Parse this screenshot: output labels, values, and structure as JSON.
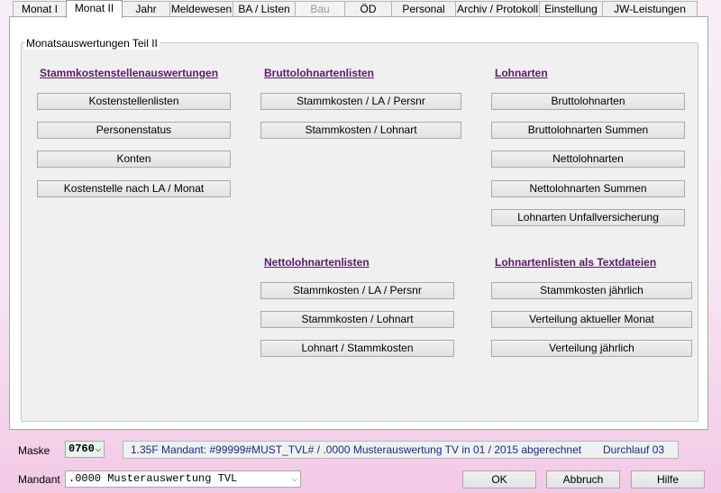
{
  "tabs": [
    {
      "label": "Monat I",
      "state": "normal"
    },
    {
      "label": "Monat II",
      "state": "active"
    },
    {
      "label": "Jahr",
      "state": "normal"
    },
    {
      "label": "Meldewesen",
      "state": "normal"
    },
    {
      "label": "BA / Listen",
      "state": "normal"
    },
    {
      "label": "Bau",
      "state": "disabled"
    },
    {
      "label": "ÖD",
      "state": "normal"
    },
    {
      "label": "Personal",
      "state": "normal"
    },
    {
      "label": "Archiv / Protokoll",
      "state": "normal"
    },
    {
      "label": "Einstellung",
      "state": "normal"
    },
    {
      "label": "JW-Leistungen",
      "state": "normal"
    }
  ],
  "group_title": "Monatsauswertungen Teil II",
  "sections": {
    "stammkosten": {
      "heading": "Stammkostenstellenauswertungen",
      "buttons": [
        "Kostenstellenlisten",
        "Personenstatus",
        "Konten",
        "Kostenstelle nach LA / Monat"
      ]
    },
    "brutto": {
      "heading": "Bruttolohnartenlisten",
      "buttons": [
        "Stammkosten / LA / Persnr",
        "Stammkosten / Lohnart"
      ]
    },
    "lohnarten": {
      "heading": "Lohnarten",
      "buttons": [
        "Bruttolohnarten",
        "Bruttolohnarten Summen",
        "Nettolohnarten",
        "Nettolohnarten Summen",
        "Lohnarten Unfallversicherung"
      ]
    },
    "netto": {
      "heading": "Nettolohnartenlisten",
      "buttons": [
        "Stammkosten / LA / Persnr",
        "Stammkosten / Lohnart",
        "Lohnart / Stammkosten"
      ]
    },
    "textdateien": {
      "heading": "Lohnartenlisten als Textdateien",
      "buttons": [
        "Stammkosten jährlich",
        "Verteilung aktueller Monat",
        "Verteilung jährlich"
      ]
    }
  },
  "footer": {
    "maske_label": "Maske",
    "maske_value": "0760",
    "status_text": "1.35F Mandant: #99999#MUST_TVL# / .0000 Musterauswertung TV in 01 / 2015 abgerechnet",
    "status_run": "Durchlauf 03",
    "mandant_label": "Mandant",
    "mandant_value": ".0000 Musterauswertung TVL",
    "ok_label": "OK",
    "abbruch_label": "Abbruch",
    "hilfe_label": "Hilfe"
  },
  "colors": {
    "heading": "#5a1a66",
    "status_text": "#1a2a8c"
  },
  "icons": {
    "dropdown": "chevron-down-icon"
  }
}
